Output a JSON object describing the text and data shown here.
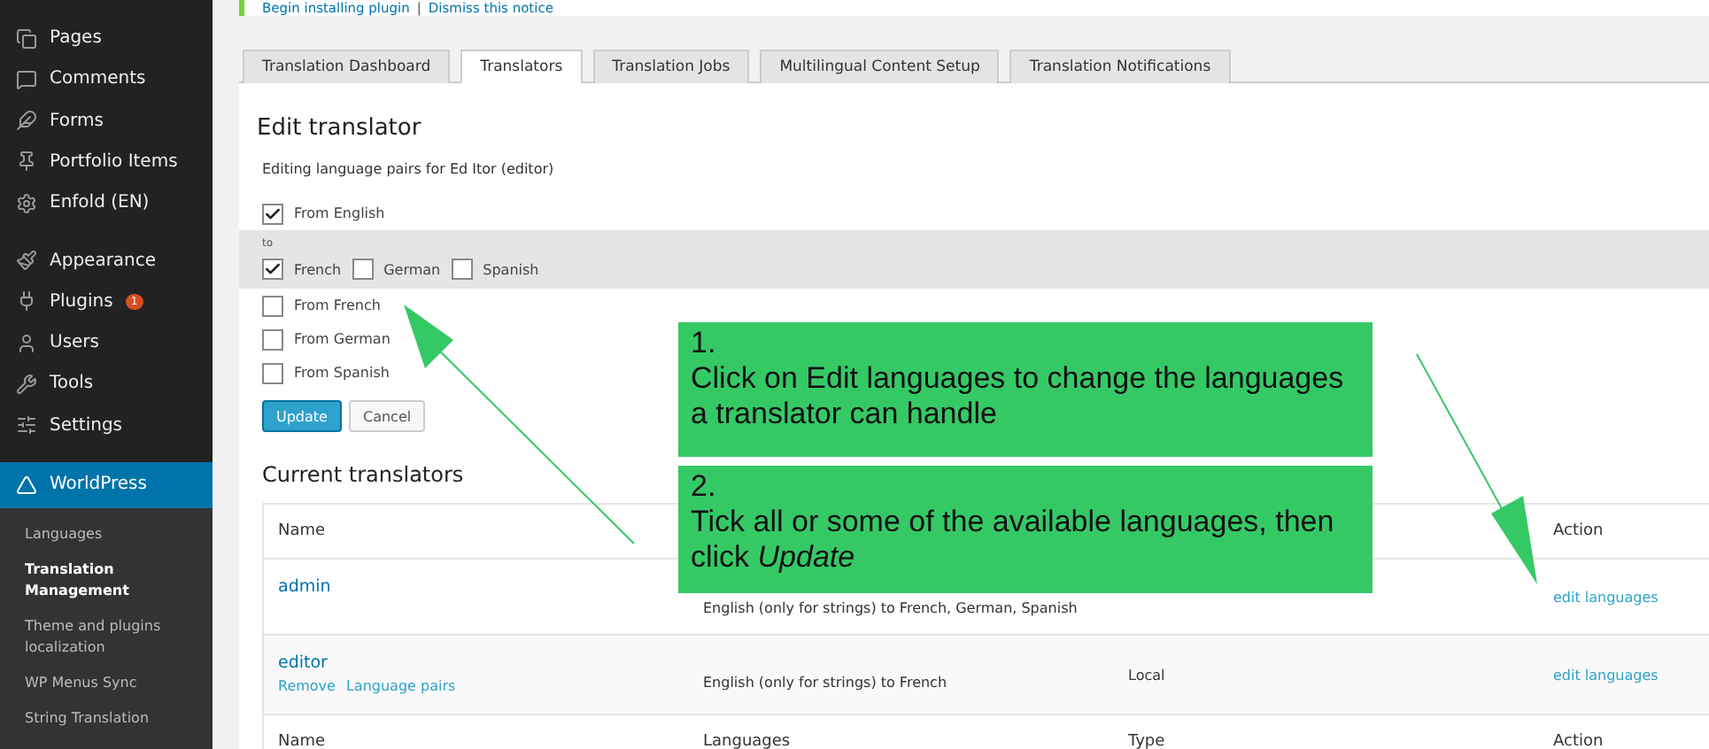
{
  "notice": {
    "links": [
      "Begin installing plugin",
      "Dismiss this notice"
    ],
    "separator": "|"
  },
  "sidebar": {
    "groups": [
      [
        {
          "label": "Pages",
          "kind": "pages",
          "selected": false
        },
        {
          "label": "Comments",
          "kind": "comments",
          "selected": false
        },
        {
          "label": "Forms",
          "kind": "forms",
          "selected": false
        },
        {
          "label": "Portfolio Items",
          "kind": "portfolio",
          "selected": false
        },
        {
          "label": "Enfold (EN)",
          "kind": "enfold",
          "selected": false
        }
      ],
      [
        {
          "label": "Appearance",
          "kind": "appearance",
          "selected": false
        },
        {
          "label": "Plugins",
          "kind": "plugins",
          "badge": "1",
          "selected": false
        },
        {
          "label": "Users",
          "kind": "users",
          "selected": false
        },
        {
          "label": "Tools",
          "kind": "tools",
          "selected": false
        },
        {
          "label": "Settings",
          "kind": "settings",
          "selected": false
        }
      ],
      [
        {
          "label": "WorldPress",
          "kind": "wpml",
          "selected": true
        }
      ]
    ],
    "submenu": [
      {
        "label": "Languages",
        "selected": false
      },
      {
        "label": "Translation Management",
        "selected": true
      },
      {
        "label": "Theme and plugins localization",
        "selected": false
      },
      {
        "label": "WP Menus Sync",
        "selected": false
      },
      {
        "label": "String Translation",
        "selected": false
      }
    ]
  },
  "tabs": [
    {
      "label": "Translation Dashboard",
      "selected": false
    },
    {
      "label": "Translators",
      "selected": true
    },
    {
      "label": "Translation Jobs",
      "selected": false
    },
    {
      "label": "Multilingual Content Setup",
      "selected": false
    },
    {
      "label": "Translation Notifications",
      "selected": false
    }
  ],
  "edit": {
    "title": "Edit translator",
    "subtitle": "Editing language pairs for Ed Itor (editor)",
    "pairs": [
      {
        "label": "From English",
        "checked": true,
        "to_label": "to",
        "targets": [
          {
            "label": "French",
            "checked": true
          },
          {
            "label": "German",
            "checked": false
          },
          {
            "label": "Spanish",
            "checked": false
          }
        ]
      },
      {
        "label": "From French",
        "checked": false
      },
      {
        "label": "From German",
        "checked": false
      },
      {
        "label": "From Spanish",
        "checked": false
      }
    ],
    "buttons": [
      {
        "label": "Update",
        "kind": "primary"
      },
      {
        "label": "Cancel",
        "kind": "secondary"
      }
    ]
  },
  "translators": {
    "title": "Current translators",
    "header": {
      "name": "Name",
      "action": "Action"
    },
    "rows": [
      {
        "name": "admin",
        "languages": "English (only for strings) to French, German, Spanish",
        "action": "edit languages"
      },
      {
        "name": "editor",
        "links": [
          "Remove",
          "Language pairs"
        ],
        "languages": "English (only for strings) to French",
        "type": "Local",
        "action": "edit languages"
      }
    ],
    "footer": {
      "name": "Name",
      "languages": "Languages",
      "type": "Type",
      "action": "Action"
    }
  },
  "callouts": [
    {
      "number": "1.",
      "text": "Click on Edit languages to change the languages a translator can handle"
    },
    {
      "number": "2.",
      "text": "Tick all or some of the available languages, then click *Update*"
    }
  ]
}
